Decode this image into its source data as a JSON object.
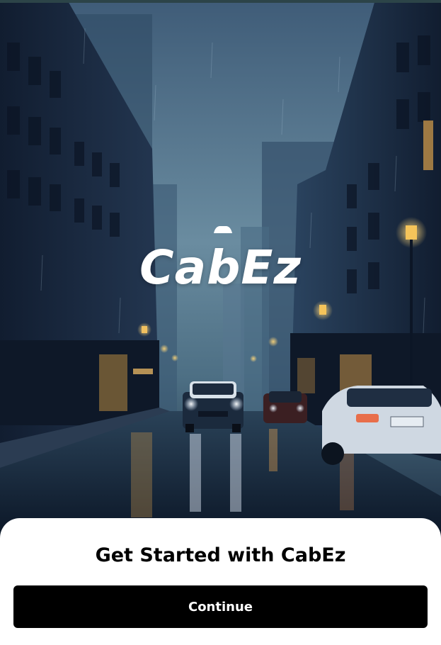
{
  "app": {
    "name": "CabEz",
    "logo_icon": "car-roof-icon"
  },
  "hero": {
    "image_description_icon": "rainy-city-street-illustration"
  },
  "onboarding": {
    "title": "Get Started with CabEz",
    "continue_label": "Continue"
  },
  "colors": {
    "sheet_background": "#ffffff",
    "button_background": "#000000",
    "button_text": "#ffffff",
    "logo_text": "#ffffff",
    "sky": "#5e7f96",
    "street_lamp": "#f5c45a"
  }
}
